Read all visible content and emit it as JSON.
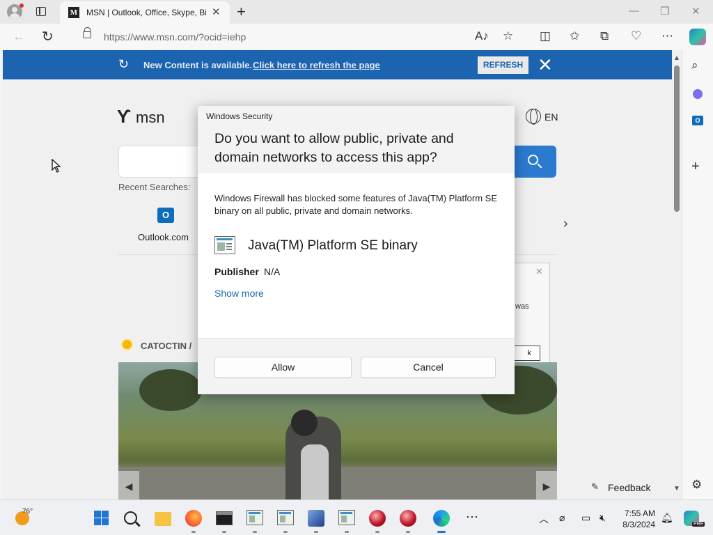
{
  "browser": {
    "tab": {
      "title": "MSN | Outlook, Office, Skype, Bi",
      "favicon_letter": "M"
    },
    "new_tab_glyph": "+",
    "address": {
      "url": "https://www.msn.com/?ocid=iehp"
    },
    "window_controls": {
      "minimize": "—",
      "restore": "❐",
      "close": "✕"
    }
  },
  "page": {
    "notification": {
      "text": "New Content is available.",
      "link": "Click here to refresh the page",
      "button": "REFRESH",
      "close": "✕"
    },
    "logo": {
      "mark": "ϒ",
      "text": "msn"
    },
    "language": "EN",
    "search": {
      "recent_label": "Recent Searches:"
    },
    "tiles": [
      {
        "label": "Outlook.com",
        "icon_letter": "O"
      }
    ],
    "weather_location": "CATOCTIN /",
    "background_dialog": {
      "close": "✕",
      "text": "was",
      "button": "k"
    },
    "feedback": {
      "label": "Feedback"
    }
  },
  "dialog": {
    "title": "Windows Security",
    "heading": "Do you want to allow public, private and domain networks to access this app?",
    "body": "Windows Firewall has blocked some features of Java(TM) Platform SE binary on all public, private and domain networks.",
    "app_name": "Java(TM) Platform SE binary",
    "publisher_label": "Publisher",
    "publisher_value": "N/A",
    "show_more": "Show more",
    "allow": "Allow",
    "cancel": "Cancel"
  },
  "taskbar": {
    "weather_temp": "76°",
    "clock": {
      "time": "7:55 AM",
      "date": "8/3/2024"
    },
    "more": "⋯",
    "copilot_badge": "PRE"
  },
  "icons": {
    "profile": "profile-avatar-icon",
    "tab_actions": "tab-actions-icon",
    "refresh": "refresh-icon",
    "lock": "lock-icon",
    "read_aloud": "read-aloud-icon",
    "favorite": "star-icon",
    "split_screen": "split-screen-icon",
    "favorites": "favorites-icon",
    "collections": "collections-icon",
    "performance": "heart-pulse-icon",
    "more": "ellipsis-icon",
    "copilot": "copilot-icon"
  },
  "colors": {
    "notification_bar": "#1c64b0",
    "search_button": "#2b7ad0",
    "link": "#1d66b7",
    "windows_accent": "#1f74d4"
  }
}
